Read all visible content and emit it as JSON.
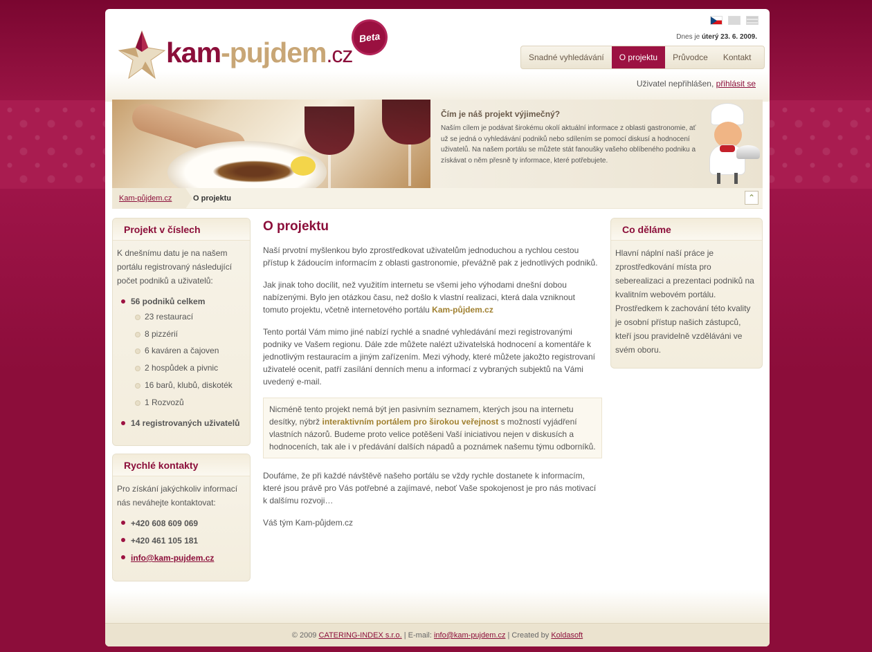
{
  "header": {
    "logo": {
      "part1": "kam",
      "dash": "-",
      "part2": "pujdem",
      "tld": ".cz"
    },
    "beta": "Beta",
    "date_prefix": "Dnes je",
    "date_value": "úterý 23. 6. 2009.",
    "nav": [
      {
        "label": "Snadné vyhledávání"
      },
      {
        "label": "O projektu"
      },
      {
        "label": "Průvodce"
      },
      {
        "label": "Kontakt"
      }
    ],
    "user_status": "Uživatel nepřihlášen,",
    "login_link": "přihlásit se"
  },
  "languages": [
    "cz-flag-icon",
    "en-flag-icon",
    "de-flag-icon"
  ],
  "banner": {
    "title": "Čím je náš projekt výjimečný?",
    "body": "Naším cílem je podávat širokému okolí aktuální informace z oblasti gastronomie, ať už se jedná o vyhledávání podniků nebo sdílením se pomocí diskusí a hodnocení uživatelů. Na našem portálu se můžete stát fanoušky vašeho oblíbeného podniku a získávat o něm přesně ty informace, které potřebujete."
  },
  "breadcrumb": {
    "home": "Kam-půjdem.cz",
    "current": "O projektu"
  },
  "left": {
    "stats": {
      "title": "Projekt v číslech",
      "intro": "K dnešnímu datu je na našem portálu registrovaný následující počet podniků a uživatelů:",
      "total": "56 podniků celkem",
      "items": [
        "23 restaurací",
        "8 pizzérií",
        "6 kaváren a čajoven",
        "2 hospůdek a pivnic",
        "16 barů, klubů, diskoték",
        "1 Rozvozů"
      ],
      "users": "14 registrovaných uživatelů"
    },
    "contacts": {
      "title": "Rychlé kontakty",
      "intro": "Pro získání jakýchkoliv informací nás neváhejte kontaktovat:",
      "phone1": "+420 608 609 069",
      "phone2": "+420 461 105 181",
      "email": "info@kam-pujdem.cz"
    }
  },
  "main": {
    "title": "O projektu",
    "p1": "Naší prvotní myšlenkou bylo zprostředkovat uživatelům jednoduchou a rychlou cestou přístup k žádoucím informacím z oblasti gastronomie, převážně pak z jednotlivých podniků.",
    "p2_text": "Jak jinak toho docílit, než využitím internetu se všemi jeho výhodami dnešní dobou nabízenými. Bylo jen otázkou času, než došlo k vlastní realizaci, která dala vzniknout tomuto projektu, včetně internetového portálu",
    "p2_bold": "Kam-půjdem.cz",
    "p3": "Tento portál Vám mimo jiné nabízí rychlé a snadné vyhledávání mezi registrovanými podniky ve Vašem regionu. Dále zde můžete nalézt uživatelská hodnocení a komentáře k jednotlivým restauracím a jiným zařízením. Mezi výhody, které můžete jakožto registrovaní uživatelé ocenit, patří zasílání denních menu a informací z vybraných subjektů na Vámi uvedený e-mail.",
    "quote_a": "Nicméně tento projekt nemá být jen pasivním seznamem, kterých jsou na internetu desítky, nýbrž",
    "quote_bold": "interaktivním portálem pro širokou veřejnost",
    "quote_b": "s možností vyjádření vlastních názorů. Budeme proto velice potěšeni Vaší iniciativou nejen v diskusích a hodnoceních, tak ale i v předávání dalších nápadů a poznámek našemu týmu odborníků.",
    "p4": "Doufáme, že při každé návštěvě našeho portálu se vždy rychle dostanete k informacím, které jsou právě pro Vás potřebné a zajímavé, neboť Vaše spokojenost je pro nás motivací k dalšímu rozvoji…",
    "signature": "Váš tým Kam-půjdem.cz"
  },
  "right": {
    "title": "Co děláme",
    "body": "Hlavní náplní naší práce je zprostředkování místa pro seberealizaci a prezentaci podniků na kvalitním webovém portálu. Prostředkem k zachování této kvality je osobní přístup našich zástupců, kteří jsou pravidelně vzděláváni ve svém oboru."
  },
  "footer": {
    "copy": "© 2009",
    "company": "CATERING-INDEX s.r.o.",
    "email_label": "| E-mail:",
    "email": "info@kam-pujdem.cz",
    "created_label": "| Created by",
    "creator": "Koldasoft"
  },
  "colors": {
    "accent": "#8b0e3a",
    "gold": "#c8a676",
    "background": "#8a0c36"
  }
}
